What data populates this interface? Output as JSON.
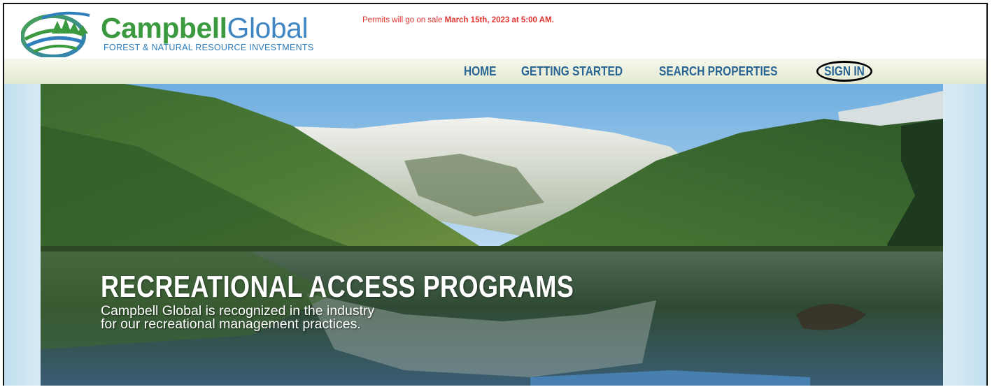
{
  "brand": {
    "name_bold": "Campbell",
    "name_thin": "Global",
    "tagline": "FOREST & NATURAL RESOURCE INVESTMENTS"
  },
  "announcement": {
    "prefix": "Permits will go on sale ",
    "date": "March 15th, 2023 at 5:00 AM."
  },
  "nav": {
    "home": "HOME",
    "getting_started": "GETTING STARTED",
    "search_properties": "SEARCH PROPERTIES",
    "sign_in": "SIGN IN"
  },
  "hero": {
    "title": "RECREATIONAL ACCESS PROGRAMS",
    "subtitle_line1": "Campbell Global is recognized in the industry",
    "subtitle_line2": "for our recreational management practices."
  },
  "colors": {
    "brand_green": "#3b9a3f",
    "brand_blue": "#3f86c2",
    "nav_text": "#2a6492",
    "announcement_red": "#e0332f"
  }
}
